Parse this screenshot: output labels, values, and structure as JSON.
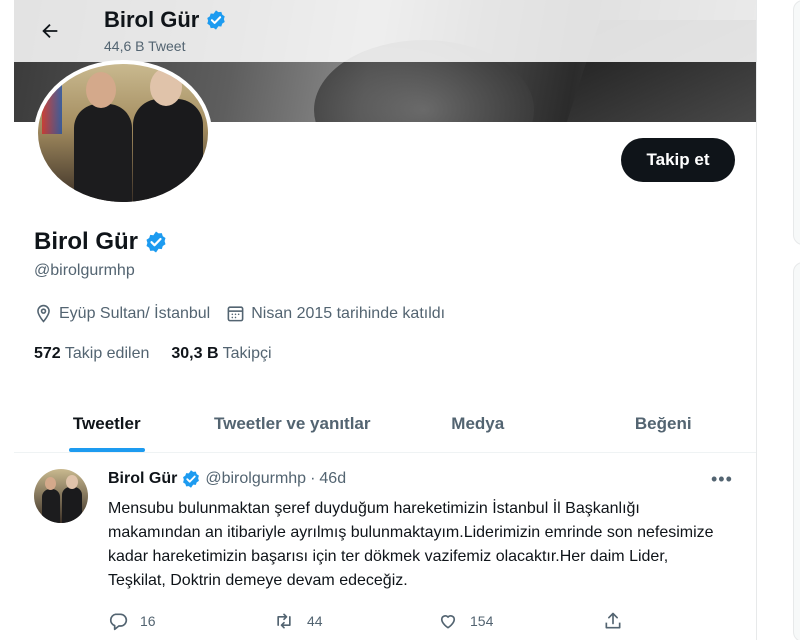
{
  "header": {
    "name": "Birol Gür",
    "tweet_count": "44,6 B Tweet"
  },
  "profile": {
    "name": "Birol Gür",
    "handle": "@birolgurmhp",
    "follow_label": "Takip et",
    "location": "Eyüp Sultan/ İstanbul",
    "joined": "Nisan 2015 tarihinde katıldı",
    "following_count": "572",
    "following_label": "Takip edilen",
    "followers_count": "30,3 B",
    "followers_label": "Takipçi"
  },
  "tabs": [
    {
      "label": "Tweetler",
      "active": true
    },
    {
      "label": "Tweetler ve yanıtlar",
      "active": false
    },
    {
      "label": "Medya",
      "active": false
    },
    {
      "label": "Beğeni",
      "active": false
    }
  ],
  "tweet": {
    "name": "Birol Gür",
    "handle": "@birolgurmhp",
    "separator": "·",
    "time": "46d",
    "more": "•••",
    "text": "Mensubu bulunmaktan şeref duyduğum hareketimizin İstanbul İl Başkanlığı makamından an itibariyle ayrılmış bulunmaktayım.Liderimizin emrinde son nefesimize kadar hareketimizin başarısı için ter dökmek vazifemiz olacaktır.Her daim Lider, Teşkilat, Doktrin demeye devam edeceğiz.",
    "replies": "16",
    "retweets": "44",
    "likes": "154"
  },
  "icons": {
    "back": "arrow-left-icon",
    "verified": "verified-badge-icon",
    "location": "location-pin-icon",
    "calendar": "calendar-icon",
    "reply": "reply-icon",
    "retweet": "retweet-icon",
    "like": "heart-icon",
    "share": "share-icon"
  },
  "colors": {
    "accent": "#1d9bf0",
    "text": "#0f1419",
    "secondary": "#536471"
  }
}
